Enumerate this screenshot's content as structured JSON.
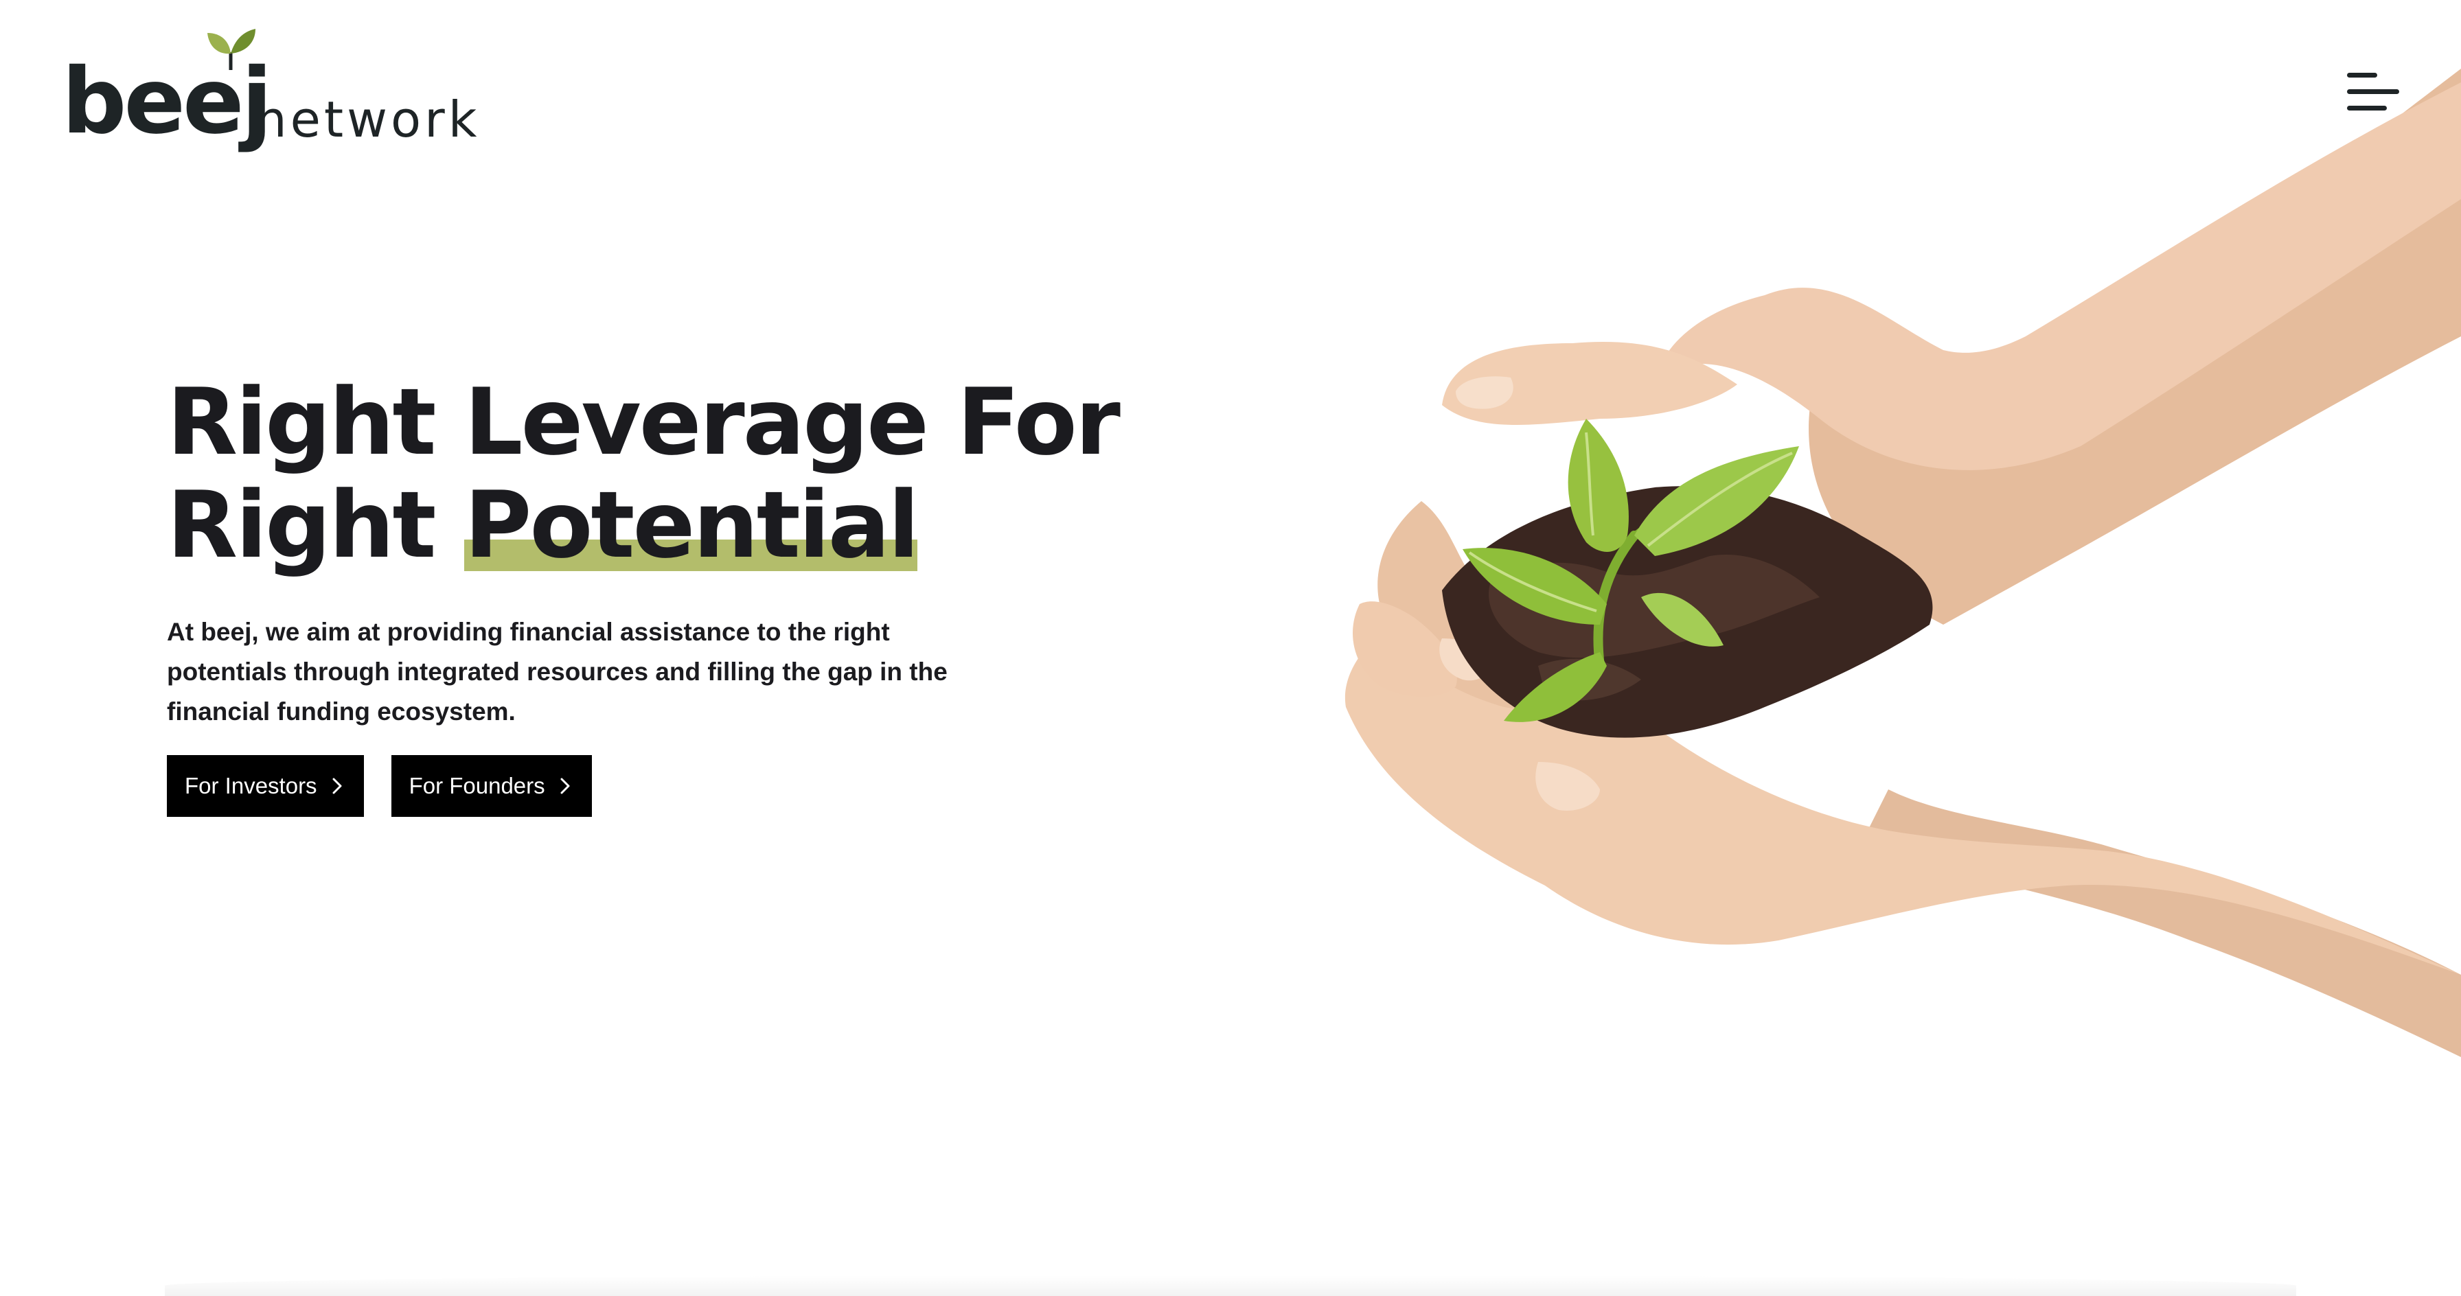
{
  "header": {
    "logo_primary": "beej",
    "logo_secondary": "network",
    "menu_icon": "hamburger-menu-icon"
  },
  "hero": {
    "headline_line1": "Right Leverage For",
    "headline_line2_prefix": "Right",
    "headline_highlight": "Potential",
    "description": "At beej, we aim at providing financial assistance to the right potentials through integrated resources and filling the gap in the financial funding ecosystem.",
    "buttons": [
      {
        "label": "For Investors",
        "icon": "chevron-right-icon"
      },
      {
        "label": "For Founders",
        "icon": "chevron-right-icon"
      }
    ],
    "illustration": "hands-holding-seedling-illustration"
  },
  "colors": {
    "background": "#ffffff",
    "text": "#1b1b1f",
    "highlight": "#b3bd6b",
    "leaf_green": "#8fbf3a",
    "button_bg": "#000000",
    "button_text": "#ffffff",
    "skin": "#f2cdb0",
    "soil": "#3a2620"
  }
}
